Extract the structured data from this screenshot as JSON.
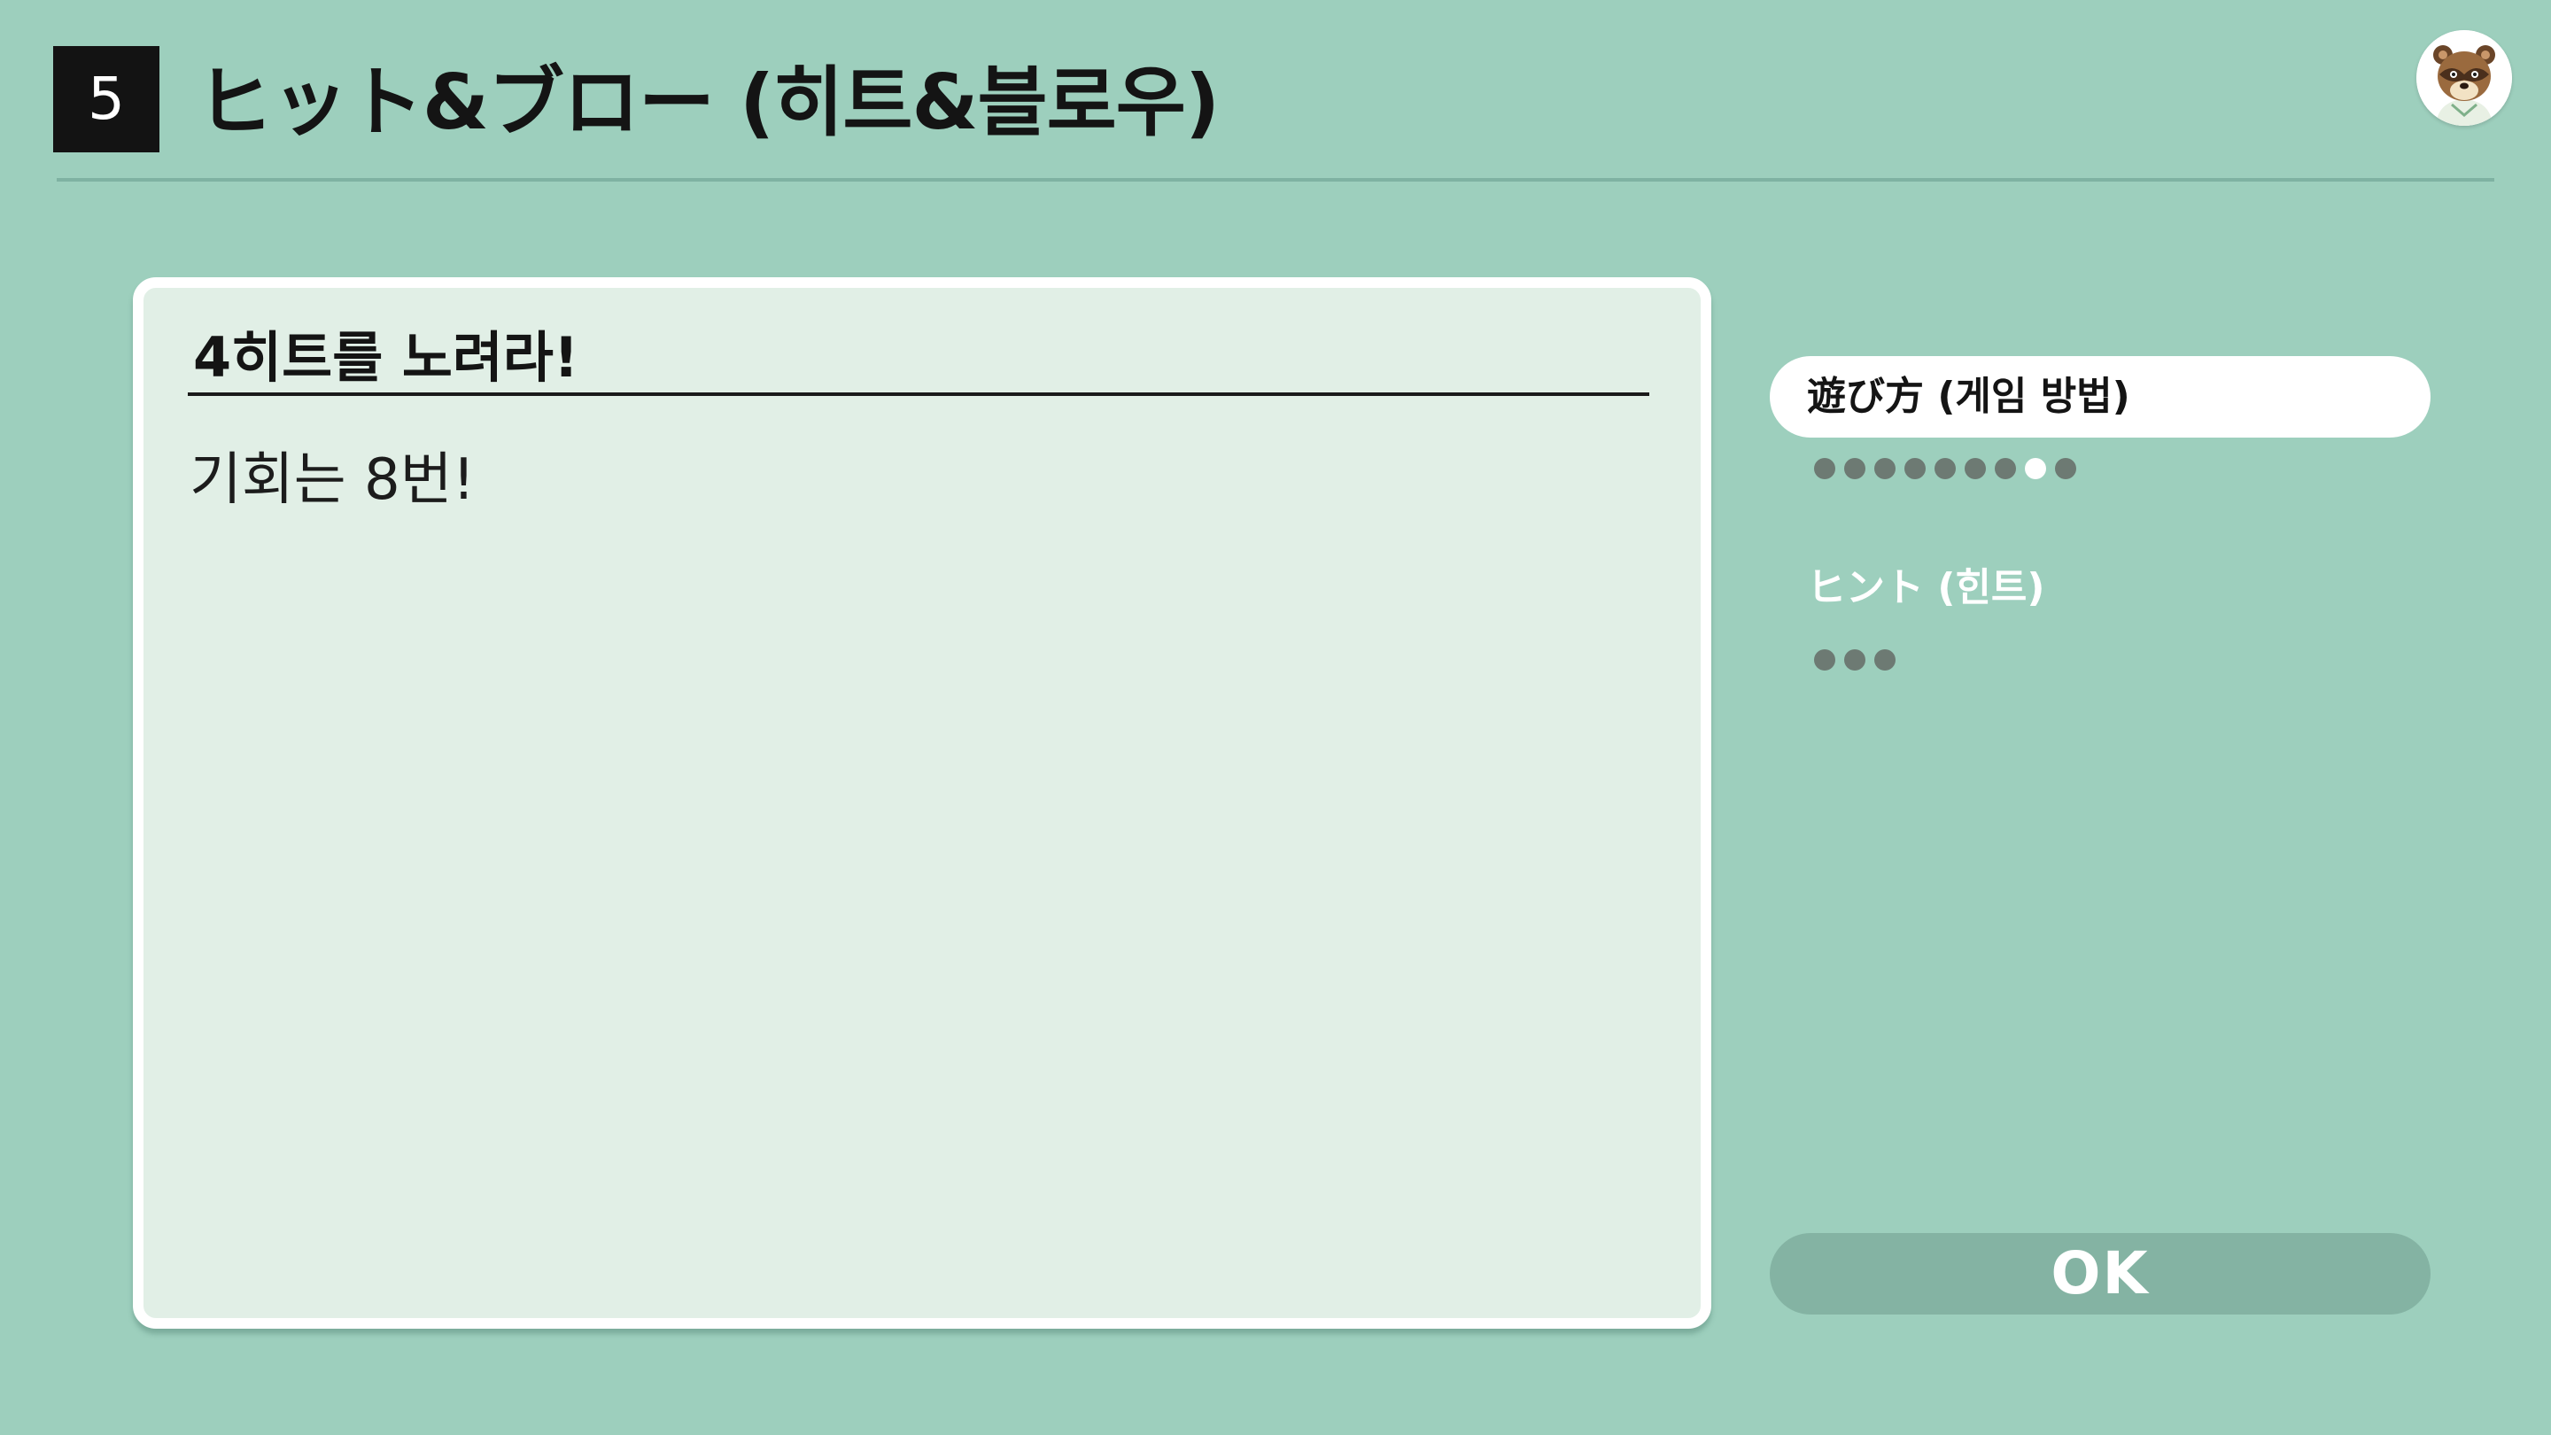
{
  "header": {
    "level_number": "5",
    "title": "ヒット&ブロー (히트&블로우)"
  },
  "panel": {
    "heading": "4히트를 노려라!",
    "body": "기회는 8번!"
  },
  "menu": {
    "items": [
      {
        "label": "遊び方 (게임 방법)",
        "selected": true,
        "page_count": 9,
        "current_page": 8
      },
      {
        "label": "ヒント (힌트)",
        "selected": false,
        "page_count": 3,
        "current_page": 0
      }
    ]
  },
  "ok_button": {
    "label": "OK"
  },
  "colors": {
    "background": "#9dcfbd",
    "panel_fill": "#e1efe6",
    "badge": "#131313",
    "dot_inactive": "#6d7a73",
    "dot_active": "#ffffff",
    "ok_button": "#84b3a3"
  },
  "icons": {
    "avatar": "tom-nook-avatar-icon"
  }
}
